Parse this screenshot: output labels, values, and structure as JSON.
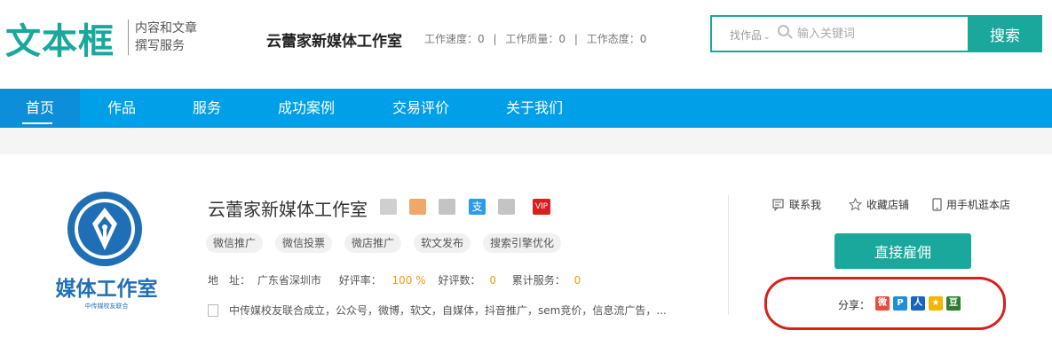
{
  "brand": {
    "logo_text": "文本框",
    "slogan_line1": "内容和文章",
    "slogan_line2": "撰写服务"
  },
  "header": {
    "shop_name": "云蕾家新媒体工作室",
    "stats": [
      {
        "label": "工作速度：0"
      },
      {
        "label": "工作质量：0"
      },
      {
        "label": "工作态度：0"
      }
    ],
    "separator": "|"
  },
  "search": {
    "category": "找作品",
    "placeholder": "输入关键词",
    "button": "搜索"
  },
  "nav": {
    "items": [
      {
        "label": "首页"
      },
      {
        "label": "作品"
      },
      {
        "label": "服务"
      },
      {
        "label": "成功案例"
      },
      {
        "label": "交易评价"
      },
      {
        "label": "关于我们"
      }
    ]
  },
  "shop": {
    "logo_title": "媒体工作室",
    "logo_subtitle": "中传媒校友联合",
    "title": "云蕾家新媒体工作室",
    "vip_label": "VIP",
    "tags": [
      "微信推广",
      "微信投票",
      "微店推广",
      "软文发布",
      "搜索引擎优化"
    ],
    "info": {
      "address_label": "地　址：",
      "address": "广东省深圳市",
      "rate_label": "好评率：",
      "rate": "100 %",
      "reviews_label": "好评数：",
      "reviews": "0",
      "served_label": "累计服务：",
      "served": "0"
    },
    "description": "中传媒校友联合成立，公众号，微博，软文，自媒体，抖音推广，sem竞价，信息流广告，..."
  },
  "actions": {
    "contact": "联系我",
    "favorite": "收藏店铺",
    "mobile": "用手机逛本店",
    "hire": "直接雇佣",
    "share_label": "分享："
  },
  "colors": {
    "brand": "#1aa89c",
    "nav": "#00a0e9",
    "accent": "#f39c12",
    "highlight_ring": "#d62020"
  }
}
